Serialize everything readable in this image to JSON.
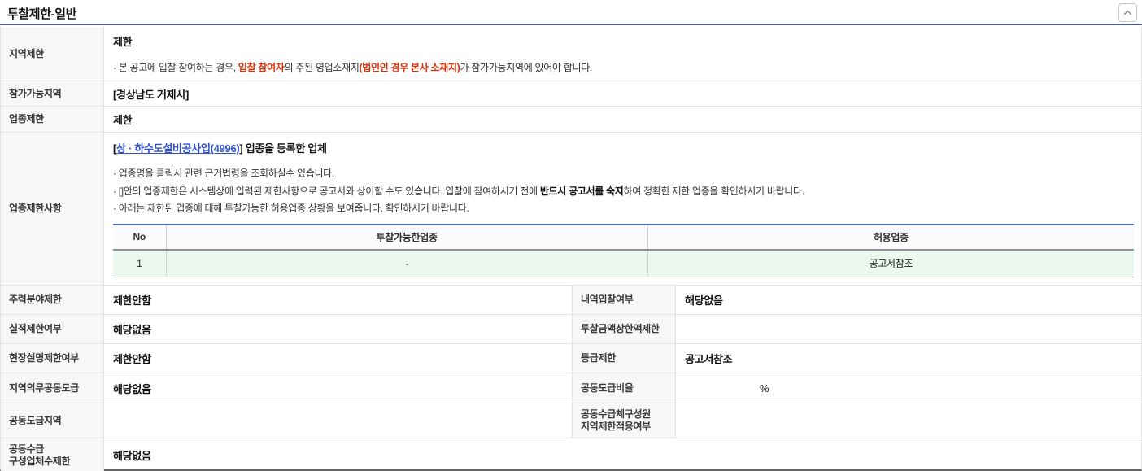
{
  "header": {
    "title": "투찰제한-일반"
  },
  "colors": {
    "title_rule": "#4a5e96",
    "table_accent_blue": "#3f6ad8",
    "highlight_row_green": "#eaf8ef",
    "emphasis_red": "#e5340b",
    "link_blue": "#2d4fd2",
    "label_bg": "#f7f7f9"
  },
  "rows": {
    "region": {
      "label": "지역제한",
      "value": "제한",
      "note": {
        "pre": "· 본 공고에 입찰 참여하는 경우, ",
        "red1": "입찰 참여자",
        "mid": "의 주된 영업소재지",
        "red2": "(법인인 경우 본사 소재지)",
        "post": "가 참가가능지역에 있어야 합니다."
      }
    },
    "area": {
      "label": "참가가능지역",
      "value": "[경상남도 거제시]"
    },
    "industry": {
      "label": "업종제한",
      "value": "제한"
    },
    "industry_detail": {
      "label": "업종제한사항",
      "registered_line": {
        "open": "[",
        "link": "상 · 하수도설비공사업(4996)",
        "close": "]",
        "suffix": " 업종을 등록한 업체"
      },
      "bullets": [
        {
          "pre": "· 업종명을 클릭시 관련 근거법령을 조회하실수 있습니다.",
          "bold": "",
          "post": ""
        },
        {
          "pre": "· []안의 업종제한은 시스템상에 입력된 제한사항으로 공고서와 상이할 수도 있습니다. 입찰에 참여하시기 전에 ",
          "bold": "반드시 공고서를 숙지",
          "post": "하여 정확한 제한 업종을 확인하시기 바랍니다."
        },
        {
          "pre": "· 아래는 제한된 업종에 대해 투찰가능한 허용업종 상황을 보여줍니다. 확인하시기 바랍니다.",
          "bold": "",
          "post": ""
        }
      ],
      "allowed_table": {
        "col_no": "No",
        "col_biddable": "투찰가능한업종",
        "col_allowed": "허용업종",
        "row": {
          "no": "1",
          "biddable": "-",
          "allowed": "공고서참조"
        }
      }
    },
    "pairs": [
      {
        "l1": "주력분야제한",
        "v1": "제한안함",
        "l2": "내역입찰여부",
        "v2": "해당없음"
      },
      {
        "l1": "실적제한여부",
        "v1": "해당없음",
        "l2": "투찰금액상한액제한",
        "v2": ""
      },
      {
        "l1": "현장설명제한여부",
        "v1": "제한안함",
        "l2": "등급제한",
        "v2": "공고서참조"
      },
      {
        "l1": "지역의무공동도급",
        "v1": "해당없음",
        "l2": "공동도급비율",
        "v2": "%"
      },
      {
        "l1": "공동도급지역",
        "v1": "",
        "l2": "공동수급체구성원\n지역제한적용여부",
        "v2": ""
      }
    ],
    "last": {
      "label": "공동수급\n구성업체수제한",
      "value": "해당없음"
    }
  }
}
